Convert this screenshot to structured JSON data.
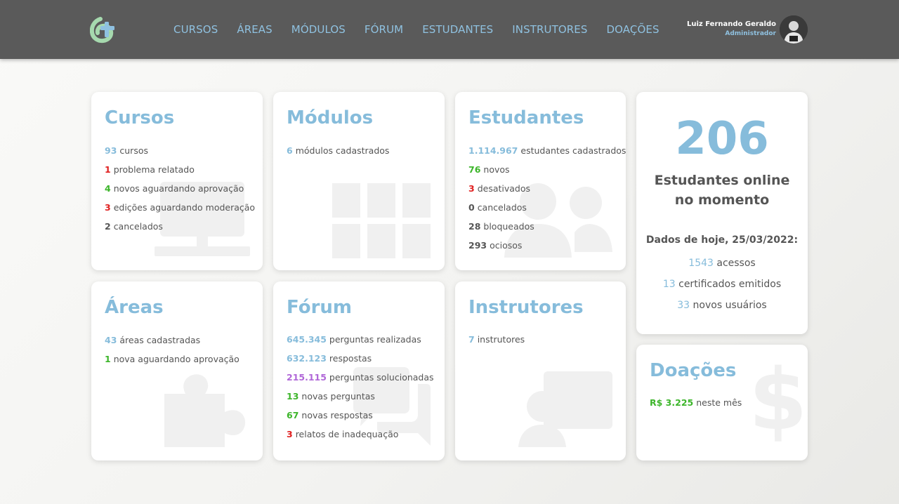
{
  "nav": {
    "items": [
      "CURSOS",
      "ÁREAS",
      "MÓDULOS",
      "FÓRUM",
      "ESTUDANTES",
      "INSTRUTORES",
      "DOAÇÕES"
    ]
  },
  "user": {
    "name": "Luiz Fernando Geraldo",
    "role": "Administrador"
  },
  "cursos": {
    "title": "Cursos",
    "lines": [
      {
        "n": "93",
        "t": "cursos"
      },
      {
        "n": "1",
        "t": "problema relatado"
      },
      {
        "n": "4",
        "t": "novos aguardando aprovação"
      },
      {
        "n": "3",
        "t": "edições aguardando moderação"
      },
      {
        "n": "2",
        "t": "cancelados"
      }
    ]
  },
  "modulos": {
    "title": "Módulos",
    "lines": [
      {
        "n": "6",
        "t": "módulos cadastrados"
      }
    ]
  },
  "estudantes": {
    "title": "Estudantes",
    "lines": [
      {
        "n": "1.114.967",
        "t": "estudantes cadastrados"
      },
      {
        "n": "76",
        "t": "novos"
      },
      {
        "n": "3",
        "t": "desativados"
      },
      {
        "n": "0",
        "t": "cancelados"
      },
      {
        "n": "28",
        "t": "bloqueados"
      },
      {
        "n": "293",
        "t": "ociosos"
      }
    ]
  },
  "online": {
    "count": "206",
    "label_line1": "Estudantes online",
    "label_line2": "no momento",
    "today": "Dados de hoje, 25/03/2022:",
    "stats": [
      {
        "n": "1543",
        "t": "acessos"
      },
      {
        "n": "13",
        "t": "certificados emitidos"
      },
      {
        "n": "33",
        "t": "novos usuários"
      }
    ]
  },
  "areas": {
    "title": "Áreas",
    "lines": [
      {
        "n": "43",
        "t": "áreas cadastradas"
      },
      {
        "n": "1",
        "t": "nova aguardando aprovação"
      }
    ]
  },
  "forum": {
    "title": "Fórum",
    "lines": [
      {
        "n": "645.345",
        "t": "perguntas realizadas"
      },
      {
        "n": "632.123",
        "t": "respostas"
      },
      {
        "n": "215.115",
        "t": "perguntas solucionadas"
      },
      {
        "n": "13",
        "t": "novas perguntas"
      },
      {
        "n": "67",
        "t": "novas respostas"
      },
      {
        "n": "3",
        "t": "relatos de inadequação"
      }
    ]
  },
  "instrutores": {
    "title": "Instrutores",
    "lines": [
      {
        "n": "7",
        "t": "instrutores"
      }
    ]
  },
  "doacoes": {
    "title": "Doações",
    "lines": [
      {
        "n": "R$ 3.225",
        "t": "neste mês"
      }
    ]
  },
  "colors": {
    "accent": "#86bcdb",
    "danger": "#e02020",
    "success": "#3cb52a",
    "highlight": "#b067d8",
    "topbar": "#5a5a5a"
  }
}
